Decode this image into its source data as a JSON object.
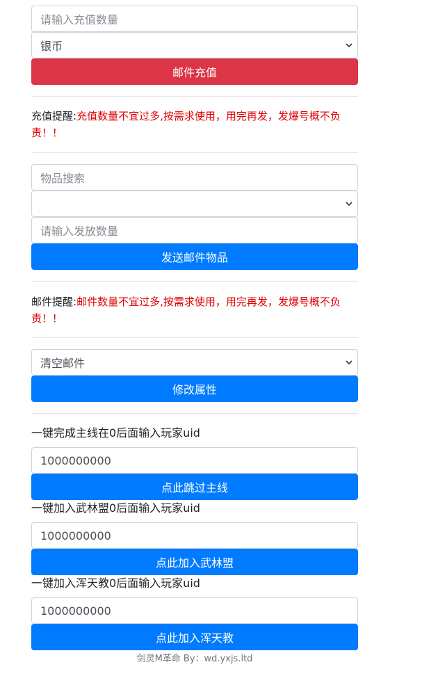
{
  "recharge": {
    "amount_placeholder": "请输入充值数量",
    "currency_selected": "银币",
    "submit_label": "邮件充值",
    "notice_prefix": "充值提醒:",
    "notice_text": "充值数量不宜过多,按需求使用，用完再发，发爆号概不负责！！"
  },
  "mail_item": {
    "search_placeholder": "物品搜索",
    "item_selected": "",
    "quantity_placeholder": "请输入发放数量",
    "submit_label": "发送邮件物品",
    "notice_prefix": "邮件提醒:",
    "notice_text": "邮件数量不宜过多,按需求使用，用完再发，发爆号概不负责！！"
  },
  "attribute": {
    "action_selected": "清空邮件",
    "submit_label": "修改属性"
  },
  "main_quest": {
    "label": "一键完成主线在0后面输入玩家uid",
    "uid_value": "1000000000",
    "submit_label": "点此跳过主线"
  },
  "wulin": {
    "label": "一键加入武林盟0后面输入玩家uid",
    "uid_value": "1000000000",
    "submit_label": "点此加入武林盟"
  },
  "huntian": {
    "label": "一键加入浑天教0后面输入玩家uid",
    "uid_value": "1000000000",
    "submit_label": "点此加入浑天教"
  },
  "footer": {
    "text": "剑灵M革命 By：wd.yxjs.ltd"
  },
  "icons": {
    "select_arrow": "chevron-down-icon"
  },
  "colors": {
    "danger": "#dc3545",
    "primary": "#007bff",
    "warning_text": "#e00000"
  }
}
